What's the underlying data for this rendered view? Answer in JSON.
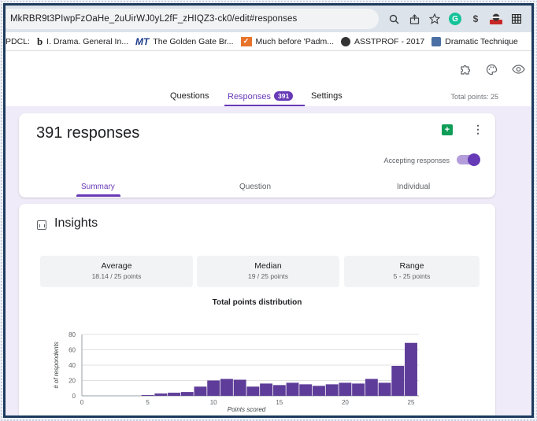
{
  "browser": {
    "url": "MkRBR9t3PIwpFzOaHe_2uUirWJ0yL2fF_zHIQZ3-ck0/edit#responses",
    "bookmarks": [
      {
        "icon": "",
        "label": "PDCL:"
      },
      {
        "icon": "b",
        "label": "I. Drama. General In..."
      },
      {
        "icon": "MT",
        "label": "The Golden Gate Br..."
      },
      {
        "icon": "",
        "label": "Much before 'Padm..."
      },
      {
        "icon": "",
        "label": "ASSTPROF - 2017"
      },
      {
        "icon": "",
        "label": "Dramatic Technique"
      }
    ],
    "extension_letter": "G"
  },
  "form": {
    "tabs": {
      "questions": "Questions",
      "responses": "Responses",
      "responses_badge": "391",
      "settings": "Settings"
    },
    "total_points": "Total points: 25"
  },
  "summary_card": {
    "title": "391 responses",
    "sheets_glyph": "+",
    "more_glyph": "⋮",
    "accepting_label": "Accepting responses",
    "accepting": true,
    "subtabs": [
      "Summary",
      "Question",
      "Individual"
    ],
    "active_subtab": "Summary"
  },
  "insights": {
    "title": "Insights",
    "stats": [
      {
        "label": "Average",
        "value": "18.14 / 25 points"
      },
      {
        "label": "Median",
        "value": "19 / 25 points"
      },
      {
        "label": "Range",
        "value": "5 - 25 points"
      }
    ]
  },
  "chart_data": {
    "type": "bar",
    "title": "Total points distribution",
    "xlabel": "Points scored",
    "ylabel": "# of respondents",
    "xlim": [
      0,
      25
    ],
    "ylim": [
      0,
      80
    ],
    "xticks": [
      0,
      5,
      10,
      15,
      20,
      25
    ],
    "yticks": [
      0,
      20,
      40,
      60,
      80
    ],
    "bar_color": "#5e3c99",
    "x": [
      5,
      6,
      7,
      8,
      9,
      10,
      11,
      12,
      13,
      14,
      15,
      16,
      17,
      18,
      19,
      20,
      21,
      22,
      23,
      24,
      25
    ],
    "values": [
      1,
      3,
      4,
      5,
      12,
      20,
      22,
      21,
      12,
      16,
      14,
      17,
      15,
      13,
      15,
      17,
      16,
      22,
      17,
      39,
      69
    ]
  }
}
